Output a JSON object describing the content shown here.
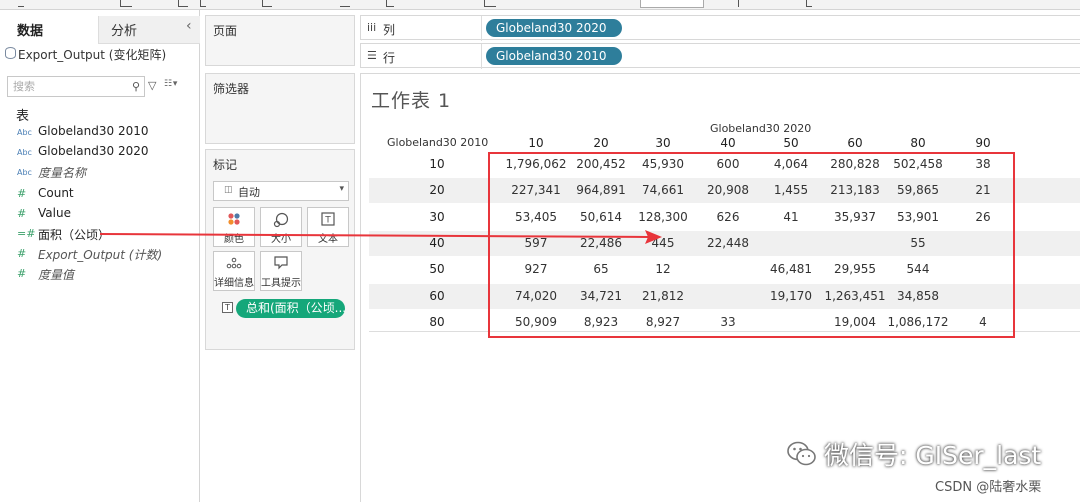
{
  "left_panel": {
    "tab_data": "数据",
    "tab_analysis": "分析",
    "collapse": "‹",
    "datasource": "Export_Output (变化矩阵)",
    "search_placeholder": "搜索",
    "tables_heading": "表",
    "fields": [
      {
        "icon": "Abc",
        "label": "Globeland30 2010"
      },
      {
        "icon": "Abc",
        "label": "Globeland30 2020"
      },
      {
        "icon": "Abc",
        "label": "度量名称"
      },
      {
        "icon": "#",
        "label": "Count"
      },
      {
        "icon": "#",
        "label": "Value"
      },
      {
        "icon": "=#",
        "label": "面积（公顷）"
      },
      {
        "icon": "#",
        "label": "Export_Output (计数)"
      },
      {
        "icon": "#",
        "label": "度量值"
      }
    ]
  },
  "cards": {
    "pages": "页面",
    "filters": "筛选器",
    "marks": "标记",
    "marks_type": "自动",
    "mark_buttons": [
      "颜色",
      "大小",
      "文本",
      "详细信息",
      "工具提示"
    ],
    "marks_text_pill_icon": "T",
    "marks_text_pill": "总和(面积（公顷..."
  },
  "shelves": {
    "columns_label": "列",
    "rows_label": "行",
    "columns_icon": "iii",
    "rows_icon": "☰",
    "columns_pill": "Globeland30 2020",
    "rows_pill": "Globeland30 2010"
  },
  "worksheet": {
    "title": "工作表 1",
    "col_field": "Globeland30 2020",
    "row_field": "Globeland30 2010",
    "columns": [
      "10",
      "20",
      "30",
      "40",
      "50",
      "60",
      "80",
      "90"
    ],
    "rows": [
      {
        "label": "10",
        "cells": [
          "1,796,062",
          "200,452",
          "45,930",
          "600",
          "4,064",
          "280,828",
          "502,458",
          "38"
        ]
      },
      {
        "label": "20",
        "cells": [
          "227,341",
          "964,891",
          "74,661",
          "20,908",
          "1,455",
          "213,183",
          "59,865",
          "21"
        ]
      },
      {
        "label": "30",
        "cells": [
          "53,405",
          "50,614",
          "128,300",
          "626",
          "41",
          "35,937",
          "53,901",
          "26"
        ]
      },
      {
        "label": "40",
        "cells": [
          "597",
          "22,486",
          "445",
          "22,448",
          "",
          "",
          "55",
          ""
        ]
      },
      {
        "label": "50",
        "cells": [
          "927",
          "65",
          "12",
          "",
          "46,481",
          "29,955",
          "544",
          ""
        ]
      },
      {
        "label": "60",
        "cells": [
          "74,020",
          "34,721",
          "21,812",
          "",
          "19,170",
          "1,263,451",
          "34,858",
          ""
        ]
      },
      {
        "label": "80",
        "cells": [
          "50,909",
          "8,923",
          "8,927",
          "33",
          "",
          "19,004",
          "1,086,172",
          "4"
        ]
      }
    ]
  },
  "watermark": {
    "text": "微信号: GISer_last",
    "credit": "CSDN @陆奢水栗"
  },
  "colors": {
    "pill_blue": "#2e7e9b",
    "pill_green": "#15a77a",
    "highlight_red": "#e8353b"
  }
}
